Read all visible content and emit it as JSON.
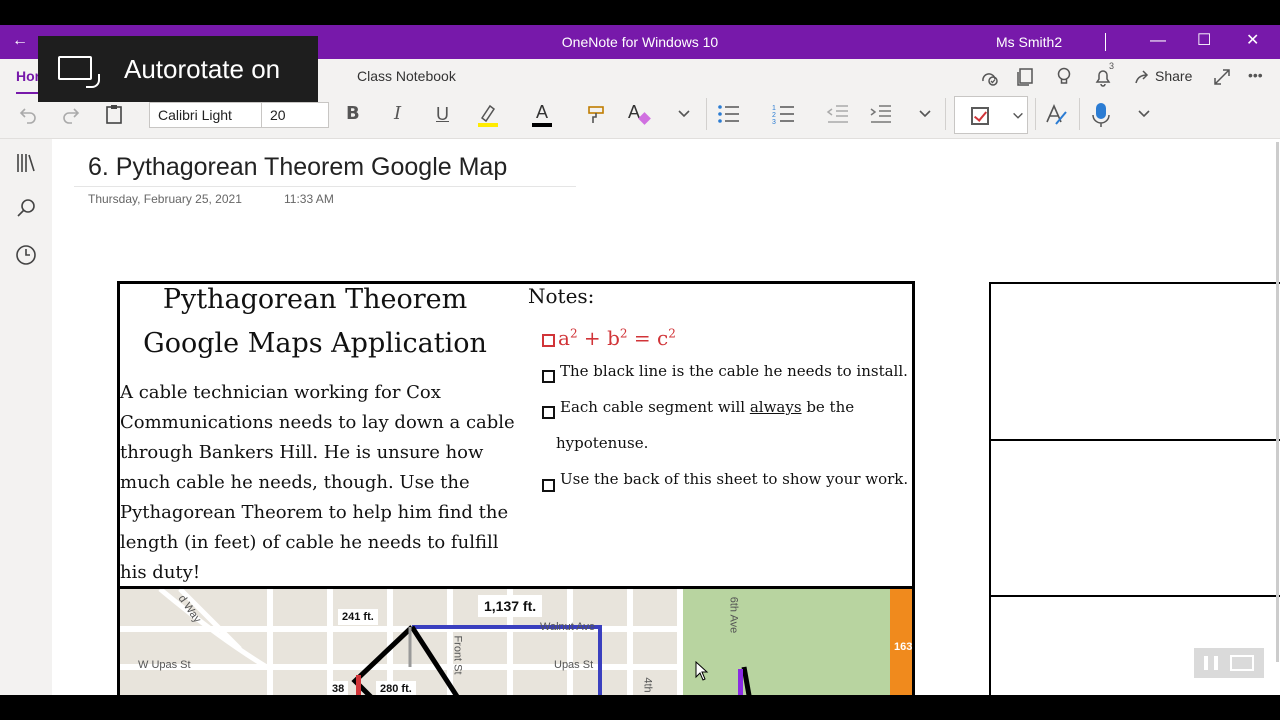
{
  "titlebar": {
    "back_icon": "←",
    "app_title": "OneNote for Windows 10",
    "user": "Ms Smith2",
    "minimize": "—",
    "maximize": "☐",
    "close": "✕"
  },
  "ribbon": {
    "tabs": [
      {
        "label": "Hor",
        "active": true
      },
      {
        "label": "Class Notebook",
        "active": false
      }
    ],
    "share_label": "Share",
    "notifications_count": "3",
    "font_name": "Calibri Light",
    "font_size": "20",
    "bold": "B",
    "italic": "I",
    "underline": "U",
    "font_color_letter": "A",
    "clear_format_letter": "A",
    "more": "•••"
  },
  "toast": {
    "text": "Autorotate on"
  },
  "page": {
    "title": "6. Pythagorean Theorem Google Map",
    "date": "Thursday, February 25, 2021",
    "time": "11:33 AM"
  },
  "worksheet": {
    "title_line1": "Pythagorean Theorem",
    "title_line2": "Google Maps Application",
    "body_lines": [
      "A cable technician working for Cox",
      "Communications needs to lay down a cable",
      "through Bankers Hill. He is unsure how",
      "much cable he needs, though. Use the",
      "Pythagorean Theorem to help him find the",
      "length (in feet) of cable he needs to fulfill",
      "his duty!"
    ],
    "notes_title": "Notes:",
    "formula": {
      "a": "a",
      "b": "b",
      "c": "c",
      "exp": "2",
      "plus": " + ",
      "eq": " = "
    },
    "notes": [
      "The black line is the cable he needs to install.",
      "Each cable segment will ",
      "always",
      " be the",
      "hypotenuse.",
      "Use the back of this sheet to show your work."
    ]
  },
  "map": {
    "labels": {
      "upas_w": "W Upas St",
      "upas": "Upas St",
      "front": "Front St",
      "walnut": "Walnut Ave",
      "fourth": "4th",
      "sixth": "6th Ave",
      "road_way": "d Way",
      "hwy": "163"
    },
    "callouts": {
      "c1137": "1,137 ft.",
      "c241": "241 ft.",
      "c280": "280 ft.",
      "c38": "38"
    },
    "colors": {
      "cable": "#000000",
      "blue": "#3a3fbf",
      "red": "#d13438",
      "purple": "#8a2be2",
      "park": "#b8d4a0",
      "highway": "#f08a1d"
    }
  },
  "colors": {
    "titlebar": "#7719AA",
    "ribbon": "#F3F2F1",
    "accent_red": "#d13438",
    "highlighter": "#ffeb00"
  }
}
